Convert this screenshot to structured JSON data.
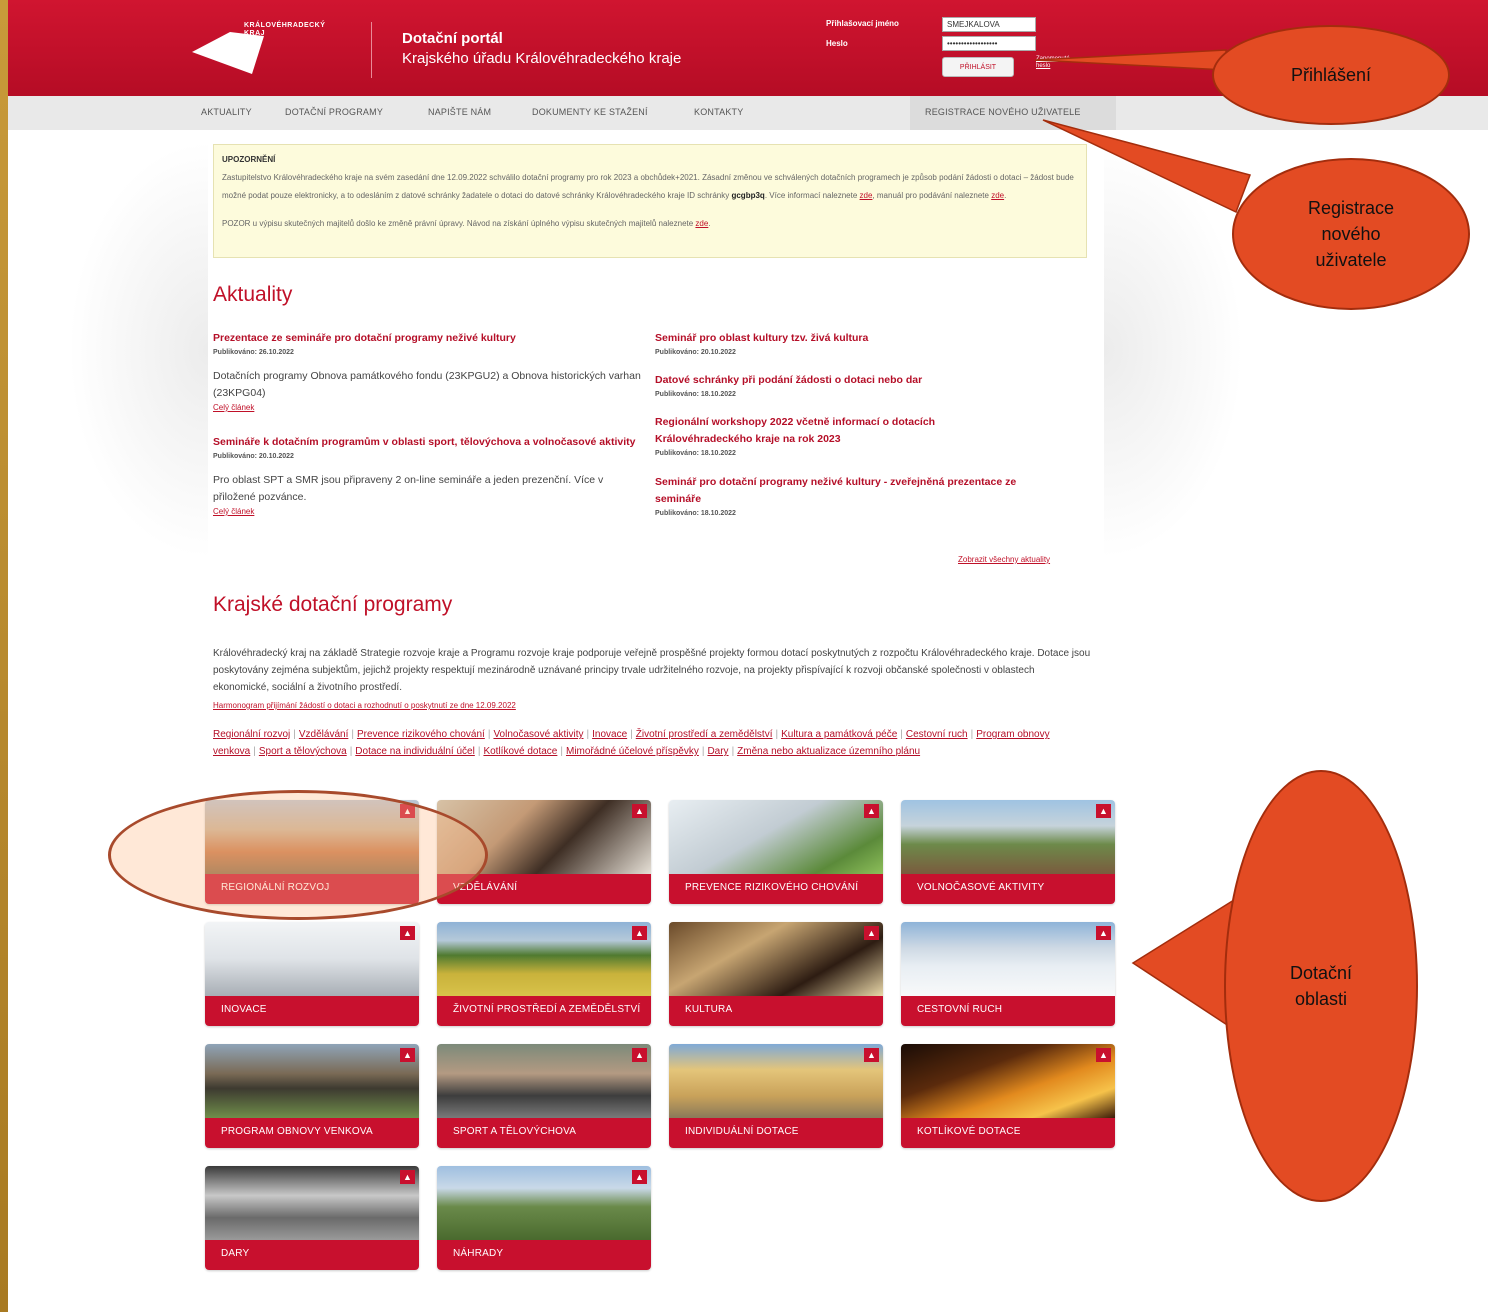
{
  "header": {
    "logo_text_1": "KRÁLOVÉHRADECKÝ",
    "logo_text_2": "KRAJ",
    "portal_title": "Dotační portál",
    "portal_subtitle": "Krajského úřadu Královéhradeckého kraje",
    "login_user_label": "Přihlašovací jméno",
    "login_pass_label": "Heslo",
    "login_user_value": "SMEJKALOVA",
    "login_pass_value": "••••••••••••••••••",
    "login_button": "PŘIHLÁSIT",
    "forgot_link": "Zapomenuté heslo"
  },
  "nav": {
    "items": [
      "AKTUALITY",
      "DOTAČNÍ PROGRAMY",
      "NAPIŠTE NÁM",
      "DOKUMENTY KE STAŽENÍ",
      "KONTAKTY"
    ],
    "register": "REGISTRACE NOVÉHO UŽIVATELE"
  },
  "notice": {
    "title": "UPOZORNĚNÍ",
    "p1_a": "Zastupitelstvo Královéhradeckého kraje na svém zasedání dne 12.09.2022 schválilo dotační programy pro rok 2023 a obchůdek+2021. Zásadní změnou ve schválených dotačních programech je způsob podání žádosti o dotaci – žádost bude možné podat pouze elektronicky, a to odesláním z datové schránky žadatele o dotaci do datové schránky Královéhradeckého kraje ID schránky ",
    "p1_id": "gcgbp3q",
    "p1_b": ". Více informací naleznete ",
    "p1_link1": "zde",
    "p1_c": ", manuál pro podávání naleznete ",
    "p1_link2": "zde",
    "p1_d": ".",
    "p2_a": "POZOR u výpisu skutečných majitelů došlo ke změně právní úpravy. Návod na získání úplného výpisu skutečných majitelů naleznete ",
    "p2_link": "zde",
    "p2_b": "."
  },
  "news": {
    "heading": "Aktuality",
    "left": [
      {
        "title": "Prezentace ze semináře pro dotační programy neživé kultury",
        "published": "Publikováno: 26.10.2022",
        "perex": "Dotačních programy Obnova památkového fondu (23KPGU2) a Obnova historických varhan (23KPG04)",
        "more": "Celý článek"
      },
      {
        "title": "Semináře k dotačním programům v oblasti sport, tělovýchova a volnočasové aktivity",
        "published": "Publikováno: 20.10.2022",
        "perex": "Pro oblast SPT a SMR jsou připraveny 2 on-line semináře a jeden prezenční. Více v přiložené pozvánce.",
        "more": "Celý článek"
      }
    ],
    "right": [
      {
        "title": "Seminář pro oblast kultury tzv. živá kultura",
        "published": "Publikováno: 20.10.2022"
      },
      {
        "title": "Datové schránky při podání žádosti o dotaci nebo dar",
        "published": "Publikováno: 18.10.2022"
      },
      {
        "title": "Regionální workshopy 2022 včetně informací o dotacích Královéhradeckého kraje na rok 2023",
        "published": "Publikováno: 18.10.2022"
      },
      {
        "title": "Seminář pro dotační programy neživé kultury - zveřejněná prezentace ze semináře",
        "published": "Publikováno: 18.10.2022"
      }
    ],
    "all_link": "Zobrazit všechny aktuality"
  },
  "programs": {
    "heading": "Krajské dotační programy",
    "text": "Královéhradecký kraj na základě Strategie rozvoje kraje a Programu rozvoje kraje podporuje veřejně prospěšné projekty formou dotací poskytnutých z rozpočtu Královéhradeckého kraje. Dotace jsou poskytovány zejména subjektům, jejichž projekty respektují mezinárodně uznávané principy trvale udržitelného rozvoje, na projekty přispívající k rozvoji občanské společnosti v oblastech ekonomické, sociální a životního prostředí.",
    "harmonogram": "Harmonogram přijímání žádostí o dotaci a rozhodnutí o poskytnutí ze dne 12.09.2022",
    "links": [
      "Regionální rozvoj",
      "Vzdělávání",
      "Prevence rizikového chování",
      "Volnočasové aktivity",
      "Inovace",
      "Životní prostředí a zemědělství",
      "Kultura a památková péče",
      "Cestovní ruch",
      "Program obnovy venkova",
      "Sport a tělovýchova",
      "Dotace na individuální účel",
      "Kotlíkové dotace",
      "Mimořádné účelové příspěvky",
      "Dary",
      "Změna nebo aktualizace územního plánu"
    ],
    "tiles": [
      "REGIONÁLNÍ ROZVOJ",
      "VZDĚLÁVÁNÍ",
      "PREVENCE RIZIKOVÉHO CHOVÁNÍ",
      "VOLNOČASOVÉ AKTIVITY",
      "INOVACE",
      "ŽIVOTNÍ PROSTŘEDÍ A ZEMĚDĚLSTVÍ",
      "KULTURA",
      "CESTOVNÍ RUCH",
      "PROGRAM OBNOVY VENKOVA",
      "SPORT A TĚLOVÝCHOVA",
      "INDIVIDUÁLNÍ DOTACE",
      "KOTLÍKOVÉ DOTACE",
      "DARY",
      "NÁHRADY"
    ]
  },
  "annotations": {
    "login": "Přihlášení",
    "register": "Registrace nového uživatele",
    "areas": "Dotační oblasti"
  },
  "colors": {
    "brand_red": "#c8102e",
    "callout_orange": "#e34b23",
    "frame_gold": "#c8962e"
  }
}
